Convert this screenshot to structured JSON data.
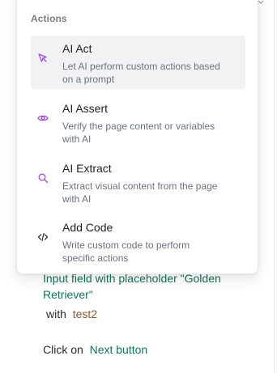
{
  "menu": {
    "section_title": "Actions",
    "items": [
      {
        "title": "AI Act",
        "description": "Let AI perform custom actions based on a prompt",
        "icon": "pointer-icon",
        "active": true
      },
      {
        "title": "AI Assert",
        "description": "Verify the page content or variables with AI",
        "icon": "eye-icon",
        "active": false
      },
      {
        "title": "AI Extract",
        "description": "Extract visual content from the page with AI",
        "icon": "magnifier-icon",
        "active": false
      },
      {
        "title": "Add Code",
        "description": "Write custom code to perform specific actions",
        "icon": "code-icon",
        "active": false
      }
    ]
  },
  "background": {
    "step1": {
      "target_line1": "Input field with placeholder \"Golden",
      "target_line2": "Retriever\"",
      "with_label": "with",
      "value": "test2"
    },
    "step2": {
      "action": "Click on",
      "target": "Next button"
    }
  },
  "colors": {
    "accent_purple": "#a44de6",
    "active_bg": "#f1f2f4",
    "target_green": "#12735a",
    "value_brown": "#8a5a2b"
  }
}
